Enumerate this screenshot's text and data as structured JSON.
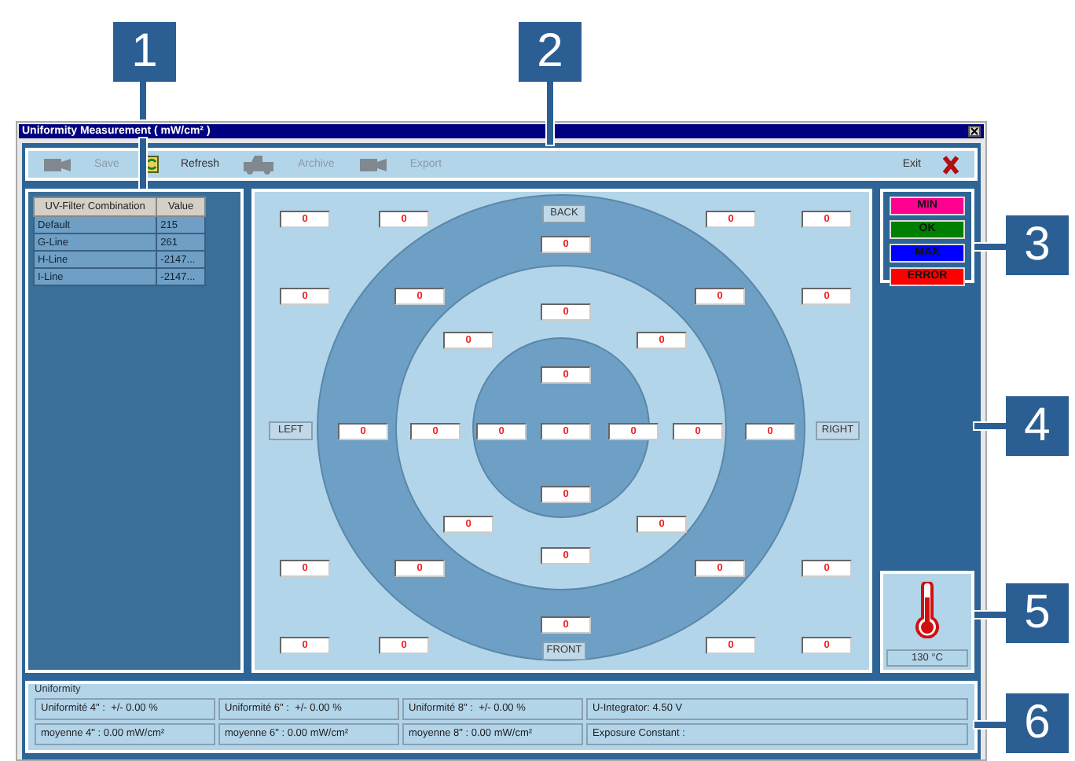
{
  "window": {
    "title": "Uniformity Measurement ( mW/cm² )"
  },
  "toolbar": [
    {
      "label": "Save",
      "kind": "camera",
      "disabled": true
    },
    {
      "label": "Refresh",
      "kind": "refresh",
      "disabled": false
    },
    {
      "label": "Archive",
      "kind": "truck",
      "disabled": true
    },
    {
      "label": "Export",
      "kind": "camera",
      "disabled": true
    },
    {
      "label": "Exit",
      "kind": "exit",
      "disabled": false
    }
  ],
  "filter_table": {
    "columns": [
      "UV-Filter Combination",
      "Value"
    ],
    "rows": [
      [
        "Default",
        "215"
      ],
      [
        "G-Line",
        "261"
      ],
      [
        "H-Line",
        "-2147..."
      ],
      [
        "I-Line",
        "-2147..."
      ]
    ]
  },
  "sensor_map": {
    "labels": [
      "BACK",
      "LEFT",
      "RIGHT",
      "FRONT"
    ],
    "readings": [
      "0",
      "0",
      "0",
      "0",
      "0",
      "0",
      "0",
      "0",
      "0",
      "0",
      "0",
      "0",
      "0",
      "0",
      "0",
      "0",
      "0",
      "0",
      "0",
      "0",
      "0",
      "0",
      "0",
      "0",
      "0",
      "0",
      "0",
      "0",
      "0",
      "0",
      "0",
      "0",
      "0"
    ]
  },
  "legend": [
    {
      "label": "MIN",
      "color": "#ff0090"
    },
    {
      "label": "OK",
      "color": "#008000"
    },
    {
      "label": "MAX",
      "color": "#0000ff"
    },
    {
      "label": "ERROR",
      "color": "#ff0000"
    }
  ],
  "temperature": "130 °C",
  "uniformity": {
    "title": "Uniformity",
    "rows": [
      [
        "Uniformité 4\" :  +/- 0.00 %",
        "Uniformité 6\" :  +/- 0.00 %",
        "Uniformité 8\" :  +/- 0.00 %",
        "U-Integrator: 4.50 V"
      ],
      [
        "moyenne 4\" : 0.00 mW/cm²",
        "moyenne 6\" : 0.00 mW/cm²",
        "moyenne 8\" : 0.00 mW/cm²",
        "Exposure Constant :"
      ]
    ]
  },
  "callouts": [
    "1",
    "2",
    "3",
    "4",
    "5",
    "6"
  ]
}
